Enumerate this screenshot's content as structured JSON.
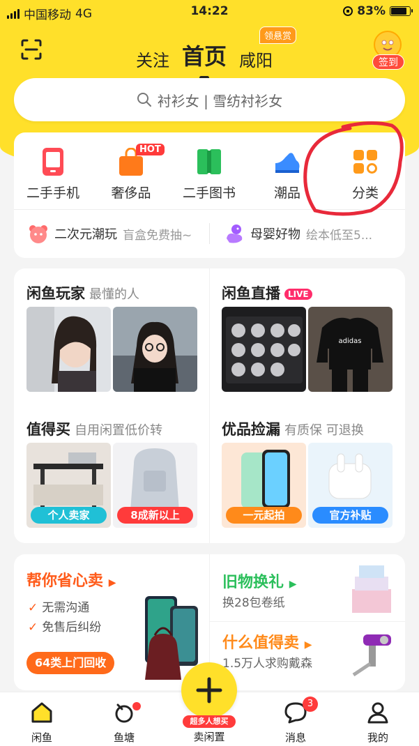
{
  "status_bar": {
    "carrier": "中国移动",
    "network": "4G",
    "time": "14:22",
    "battery": "83%",
    "battery_level": 0.83
  },
  "header": {
    "tabs": [
      "关注",
      "首页",
      "咸阳"
    ],
    "active_tab": "首页",
    "reward_badge": "领悬赏",
    "checkin_label": "签到"
  },
  "search": {
    "placeholder": "衬衫女 | 雪纺衬衫女"
  },
  "categories": [
    {
      "label": "二手手机",
      "icon": "phone-icon"
    },
    {
      "label": "奢侈品",
      "icon": "bag-icon",
      "badge": "HOT"
    },
    {
      "label": "二手图书",
      "icon": "book-icon"
    },
    {
      "label": "潮品",
      "icon": "sneaker-icon"
    },
    {
      "label": "分类",
      "icon": "grid-icon"
    }
  ],
  "promos": [
    {
      "title": "二次元潮玩",
      "subtitle": "盲盒免费抽~"
    },
    {
      "title": "母婴好物",
      "subtitle": "绘本低至5..."
    }
  ],
  "feed": {
    "player": {
      "title": "闲鱼玩家",
      "subtitle": "最懂的人"
    },
    "live": {
      "title": "闲鱼直播",
      "badge": "LIVE"
    },
    "deals": {
      "title": "值得买",
      "subtitle": "自用闲置低价转",
      "pills": [
        "个人卖家",
        "8成新以上"
      ]
    },
    "picks": {
      "title": "优品捡漏",
      "subtitle": "有质保 可退换",
      "pills": [
        "一元起拍",
        "官方补贴"
      ]
    }
  },
  "bottom": {
    "recycle": {
      "title": "帮你省心卖",
      "checks": [
        "无需沟通",
        "免售后纠纷"
      ],
      "button": "64类上门回收"
    },
    "exchange": {
      "title": "旧物换礼",
      "subtitle": "换28包卷纸"
    },
    "worth": {
      "title": "什么值得卖",
      "subtitle": "1.5万人求购戴森"
    }
  },
  "tabbar": {
    "items": [
      {
        "label": "闲鱼",
        "icon": "fish-home-icon"
      },
      {
        "label": "鱼塘",
        "icon": "pond-icon"
      },
      {
        "label": "卖闲置",
        "icon": "plus-icon"
      },
      {
        "label": "消息",
        "icon": "message-icon",
        "badge": "3"
      },
      {
        "label": "我的",
        "icon": "profile-icon"
      }
    ],
    "sell_tag": "超多人想买"
  },
  "colors": {
    "brand_yellow": "#ffe02a",
    "accent_red": "#ff3b3b",
    "orange": "#ff6a1a",
    "green": "#2bbf5b"
  }
}
